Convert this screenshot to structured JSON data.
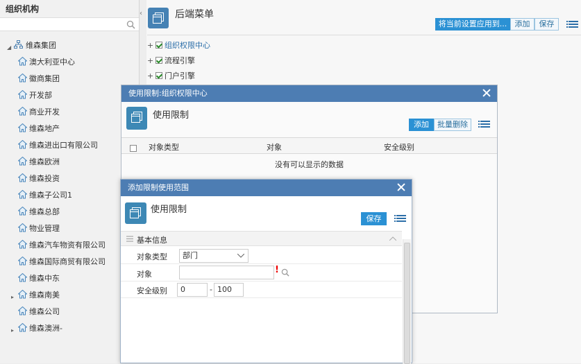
{
  "left_panel": {
    "title": "组织机构",
    "search_placeholder": "",
    "tree": [
      {
        "label": "维森集团",
        "expanded": true,
        "root": true
      },
      {
        "label": "澳大利亚中心"
      },
      {
        "label": "徽商集团"
      },
      {
        "label": "开发部"
      },
      {
        "label": "商业开发"
      },
      {
        "label": "维森地产"
      },
      {
        "label": "维森进出口有限公司"
      },
      {
        "label": "维森欧洲"
      },
      {
        "label": "维森投资"
      },
      {
        "label": "维森子公司1"
      },
      {
        "label": "维森总部"
      },
      {
        "label": "物业管理"
      },
      {
        "label": "维森汽车物资有限公司"
      },
      {
        "label": "维森国际商贸有限公司"
      },
      {
        "label": "维森中东"
      },
      {
        "label": "维森南美",
        "collapsed": true
      },
      {
        "label": "维森公司"
      },
      {
        "label": "维森澳洲-",
        "collapsed": true
      }
    ]
  },
  "main": {
    "title": "后端菜单",
    "toolbar": {
      "apply_label": "将当前设置应用到...",
      "add_label": "添加",
      "save_label": "保存"
    },
    "menu_tree": [
      {
        "label": "组织权限中心",
        "checked": true,
        "highlight": true
      },
      {
        "label": "流程引擎",
        "checked": true
      },
      {
        "label": "门户引擎",
        "checked": true
      }
    ]
  },
  "usage_dialog": {
    "title": "使用限制:组织权限中心",
    "heading": "使用限制",
    "add_label": "添加",
    "batch_delete_label": "批量删除",
    "columns": [
      "对象类型",
      "对象",
      "安全级别"
    ],
    "empty_text": "没有可以显示的数据"
  },
  "scope_dialog": {
    "title": "添加限制使用范围",
    "heading": "使用限制",
    "save_label": "保存",
    "section_label": "基本信息",
    "fields": {
      "type_label": "对象类型",
      "type_value": "部门",
      "object_label": "对象",
      "object_value": "",
      "level_label": "安全级别",
      "level_min": "0",
      "level_sep": "-",
      "level_max": "100"
    }
  },
  "colors": {
    "accent": "#2b91d4",
    "dialog_bar": "#4d7db3",
    "icon_bg": "#3d88b5"
  }
}
